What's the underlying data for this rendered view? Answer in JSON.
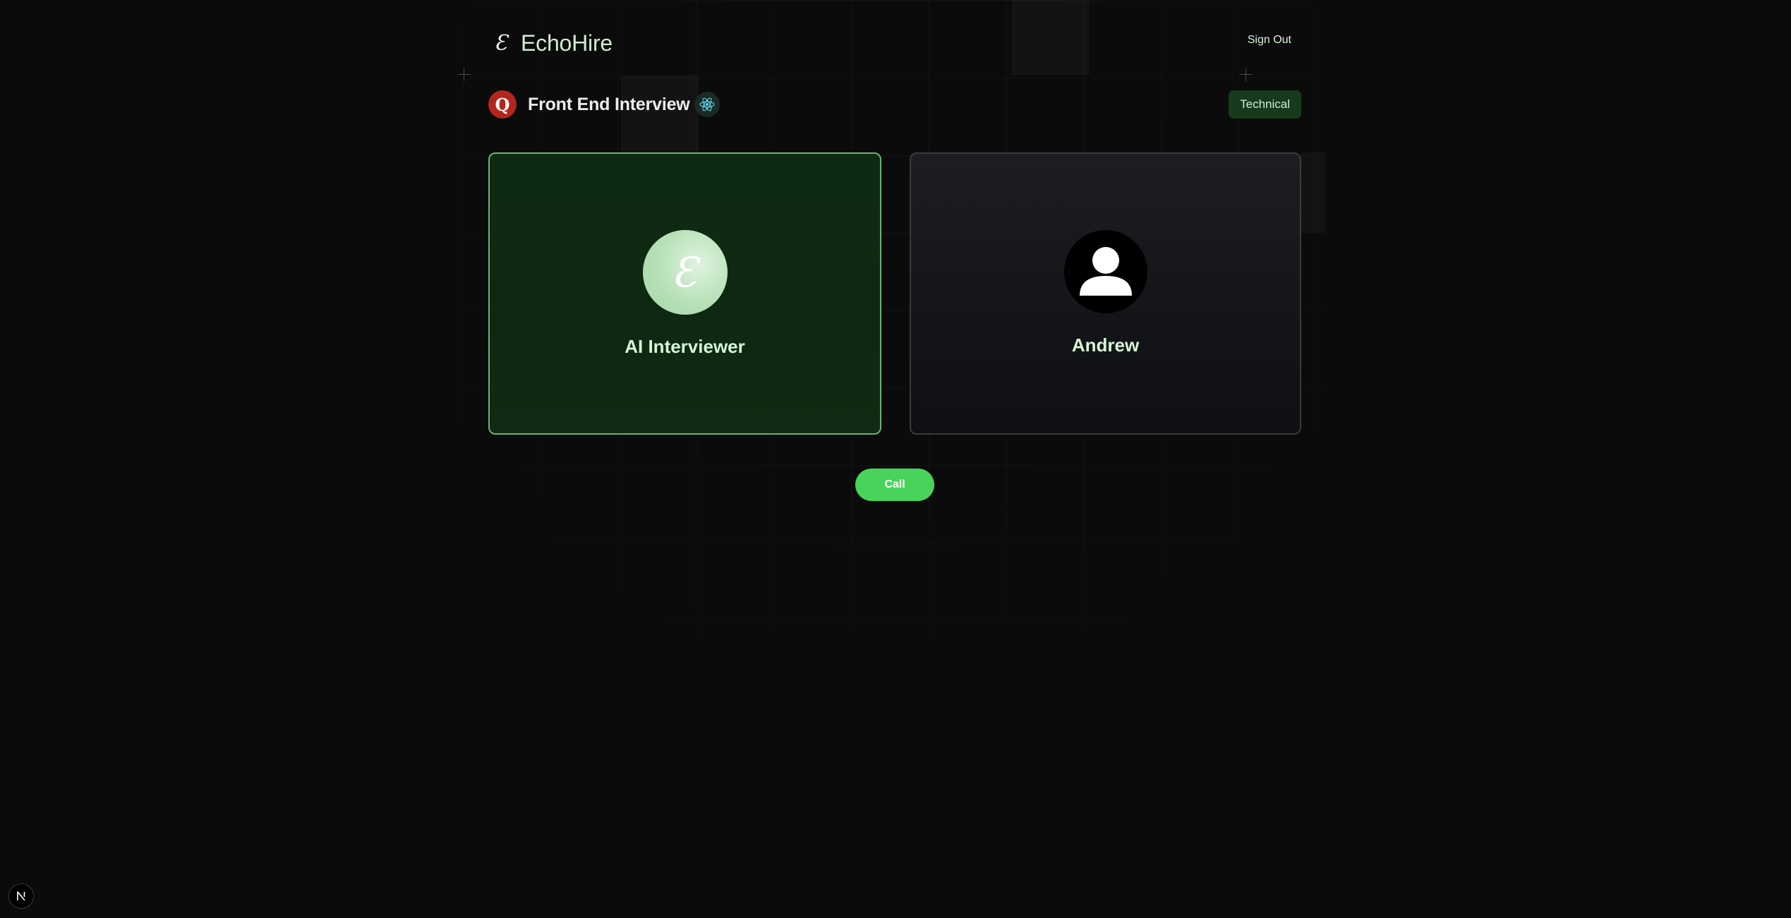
{
  "brand": {
    "mark": "Ɛ",
    "name": "EchoHire"
  },
  "nav": {
    "sign_out": "Sign Out"
  },
  "interview": {
    "logo_letter": "Q",
    "title": "Front End Interview",
    "tech_icon": "react-icon",
    "type": "Technical"
  },
  "cards": {
    "ai": {
      "avatar_mark": "Ɛ",
      "name": "AI Interviewer"
    },
    "user": {
      "avatar_icon": "user-icon",
      "name": "Andrew"
    }
  },
  "call_button": {
    "label": "Call"
  },
  "dev_badge": {
    "letter": "N"
  },
  "colors": {
    "background": "#0b0b0b",
    "accent_green": "#48d45a",
    "ai_card_border": "#67b56d",
    "badge_bg": "#173a1d",
    "q_logo": "#b3261e"
  }
}
